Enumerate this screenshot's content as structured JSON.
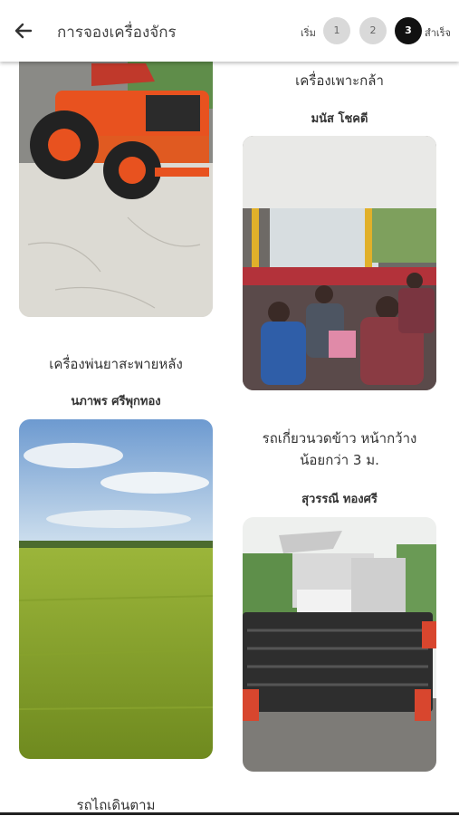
{
  "header": {
    "title": "การจองเครื่องจักร",
    "step_start_label": "เริ่ม",
    "steps": [
      "1",
      "2",
      "3"
    ],
    "step_end_label": "สำเร็จ",
    "active_step": "3"
  },
  "machines": [
    {
      "name": "เครื่องเพาะกล้า",
      "owner": "มนัส โชคดี"
    },
    {
      "name": "เครื่องพ่นยาสะพายหลัง",
      "owner": "นภาพร ศรีพุกทอง"
    },
    {
      "name_line1": "รถเกี่ยวนวดข้าว หน้ากว้าง",
      "name_line2": "น้อยกว่า 3 ม.",
      "owner": "สุวรรณี ทองศรี"
    },
    {
      "name": "รถไถเดินตาม"
    }
  ]
}
